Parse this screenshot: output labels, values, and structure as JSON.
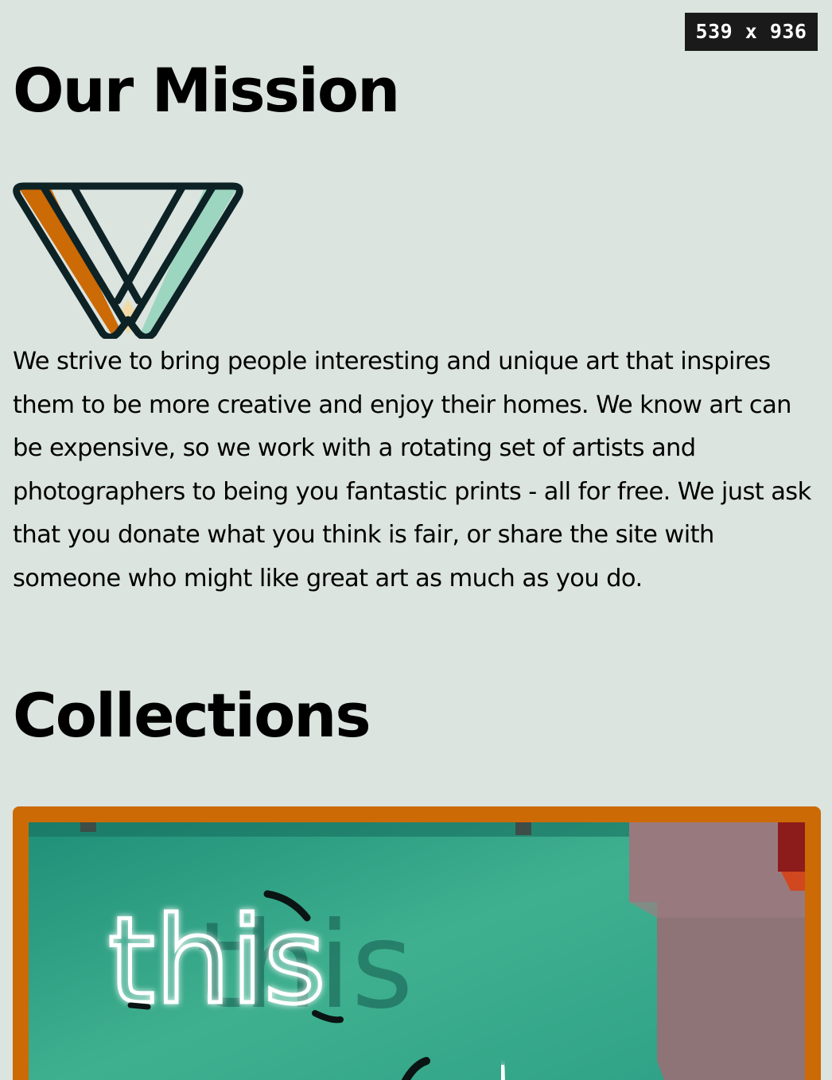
{
  "viewport_badge": "539 x 936",
  "mission": {
    "title": "Our Mission",
    "logo_icon": "v-stripes-logo-icon",
    "body": "We strive to bring people interesting and unique art that inspires them to be more creative and enjoy their homes. We know art can be expensive, so we work with a rotating set of artists and photographers to being you fantastic prints - all for free. We just ask that you donate what you think is fair, or share the site with someone who might like great art as much as you do."
  },
  "collections": {
    "title": "Collections",
    "card_border_color": "#cc6a06",
    "items": [
      {
        "image_text": "this"
      }
    ]
  },
  "colors": {
    "background": "#dce4e0",
    "accent_orange": "#cc6a06",
    "accent_mint": "#9dd6c0",
    "accent_cream": "#f0dba8",
    "outline": "#0d2225"
  }
}
